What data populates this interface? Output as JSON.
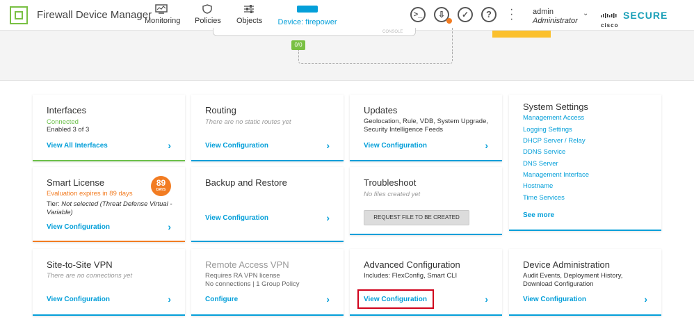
{
  "header": {
    "app_title": "Firewall Device Manager",
    "nav": {
      "monitoring": "Monitoring",
      "policies": "Policies",
      "objects": "Objects",
      "device": "Device: firepower"
    },
    "user": {
      "name": "admin",
      "role": "Administrator"
    },
    "brand": {
      "cisco": "cisco",
      "secure": "SECURE"
    }
  },
  "diagram": {
    "console_label": "CONSOLE",
    "port_label": "0/0"
  },
  "cards": {
    "interfaces": {
      "title": "Interfaces",
      "status": "Connected",
      "enabled": "Enabled 3 of 3",
      "link": "View All Interfaces"
    },
    "routing": {
      "title": "Routing",
      "note": "There are no static routes yet",
      "link": "View Configuration"
    },
    "updates": {
      "title": "Updates",
      "desc": "Geolocation, Rule, VDB, System Upgrade, Security Intelligence Feeds",
      "link": "View Configuration"
    },
    "system_settings": {
      "title": "System Settings",
      "links": [
        "Management Access",
        "Logging Settings",
        "DHCP Server / Relay",
        "DDNS Service",
        "DNS Server",
        "Management Interface",
        "Hostname",
        "Time Services"
      ],
      "see_more": "See more"
    },
    "smart_license": {
      "title": "Smart License",
      "eval": "Evaluation expires in 89 days",
      "tier_label": "Tier:",
      "tier_value": "Not selected (Threat Defense Virtual - Variable)",
      "link": "View Configuration",
      "days_num": "89",
      "days_lbl": "DAYS"
    },
    "backup": {
      "title": "Backup and Restore",
      "link": "View Configuration"
    },
    "troubleshoot": {
      "title": "Troubleshoot",
      "note": "No files created yet",
      "button": "REQUEST FILE TO BE CREATED"
    },
    "s2s_vpn": {
      "title": "Site-to-Site VPN",
      "note": "There are no connections yet",
      "link": "View Configuration"
    },
    "ra_vpn": {
      "title": "Remote Access VPN",
      "line1": "Requires RA VPN license",
      "line2": "No connections | 1 Group Policy",
      "link": "Configure"
    },
    "advanced": {
      "title": "Advanced Configuration",
      "desc": "Includes: FlexConfig, Smart CLI",
      "link": "View Configuration"
    },
    "device_admin": {
      "title": "Device Administration",
      "desc": "Audit Events, Deployment History, Download Configuration",
      "link": "View Configuration"
    }
  },
  "colors": {
    "accent": "#049fd9",
    "green": "#6cc04a",
    "orange": "#f27c22",
    "highlight": "#d0021b"
  }
}
